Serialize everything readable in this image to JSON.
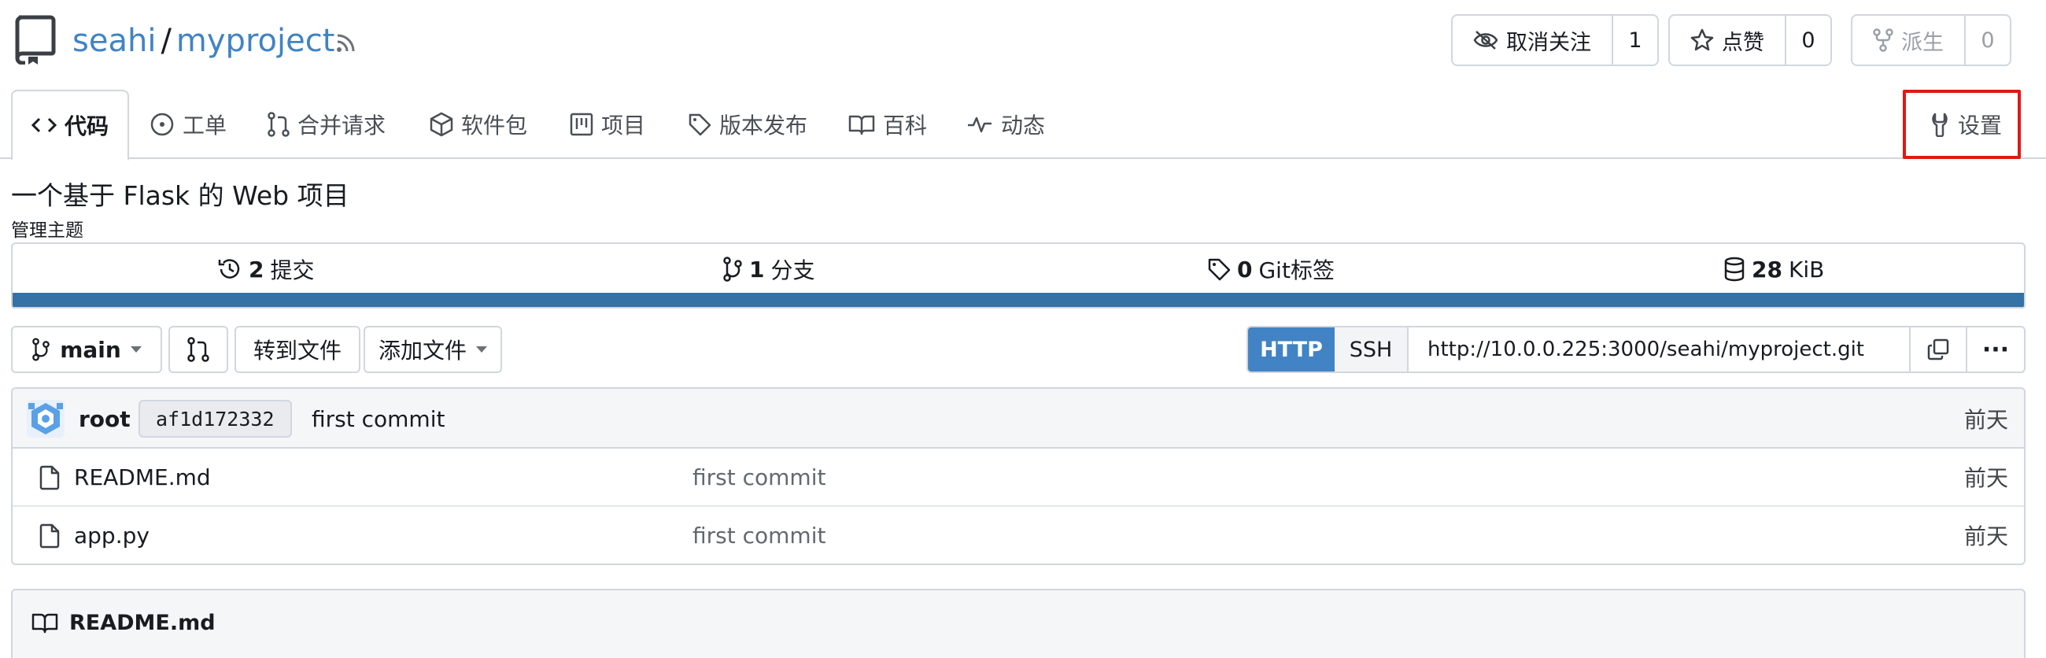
{
  "header": {
    "owner": "seahi",
    "separator": "/",
    "repo": "myproject"
  },
  "actions": {
    "watch": {
      "label": "取消关注",
      "count": "1",
      "icon": "eye-slash-icon"
    },
    "star": {
      "label": "点赞",
      "count": "0",
      "icon": "star-icon"
    },
    "fork": {
      "label": "派生",
      "count": "0",
      "icon": "fork-icon",
      "disabled": true
    }
  },
  "tabs": [
    {
      "label": "代码",
      "icon": "code-icon",
      "active": true
    },
    {
      "label": "工单",
      "icon": "issue-icon"
    },
    {
      "label": "合并请求",
      "icon": "pull-request-icon"
    },
    {
      "label": "软件包",
      "icon": "package-icon"
    },
    {
      "label": "项目",
      "icon": "project-icon"
    },
    {
      "label": "版本发布",
      "icon": "tag-icon"
    },
    {
      "label": "百科",
      "icon": "book-icon"
    },
    {
      "label": "动态",
      "icon": "pulse-icon"
    }
  ],
  "settings_tab": {
    "label": "设置",
    "icon": "wrench-icon",
    "highlighted": true
  },
  "repo_info": {
    "description": "一个基于 Flask 的 Web 项目",
    "manage_topics": "管理主题"
  },
  "stats": {
    "commits": {
      "count": "2",
      "label": "提交"
    },
    "branches": {
      "count": "1",
      "label": "分支"
    },
    "tags": {
      "count": "0",
      "label": "Git标签"
    },
    "size": {
      "count": "28",
      "label": "KiB"
    },
    "language_color": "#3572a5"
  },
  "toolbar": {
    "branch": "main",
    "go_to_file": "转到文件",
    "add_file": "添加文件"
  },
  "clone": {
    "http_label": "HTTP",
    "ssh_label": "SSH",
    "url": "http://10.0.0.225:3000/seahi/myproject.git",
    "more": "···"
  },
  "latest_commit": {
    "author": "root",
    "sha": "af1d172332",
    "message": "first commit",
    "time": "前天"
  },
  "files": [
    {
      "name": "README.md",
      "message": "first commit",
      "time": "前天"
    },
    {
      "name": "app.py",
      "message": "first commit",
      "time": "前天"
    }
  ],
  "readme": {
    "title": "README.md"
  },
  "colors": {
    "link": "#4183c4",
    "primary": "#4183c4",
    "highlight_box": "#e01818",
    "border": "#d0d7de"
  }
}
